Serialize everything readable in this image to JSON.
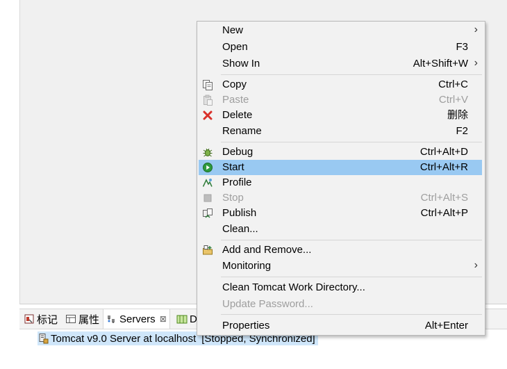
{
  "views": {
    "tabs": [
      {
        "label": "标记",
        "icon": "markers-icon"
      },
      {
        "label": "属性",
        "icon": "properties-icon"
      },
      {
        "label": "Servers",
        "icon": "servers-icon",
        "close": "⊠"
      },
      {
        "label": "D",
        "icon": "data-source-explorer-icon"
      }
    ]
  },
  "server": {
    "name": "Tomcat v9.0 Server at localhost",
    "status": "[Stopped, Synchronized]"
  },
  "context_menu": {
    "items": [
      {
        "label": "New",
        "shortcut": "",
        "submenu": true
      },
      {
        "label": "Open",
        "shortcut": "F3"
      },
      {
        "label": "Show In",
        "shortcut": "Alt+Shift+W",
        "submenu": true
      },
      {
        "label": "Copy",
        "shortcut": "Ctrl+C",
        "icon": "copy-icon"
      },
      {
        "label": "Paste",
        "shortcut": "Ctrl+V",
        "icon": "paste-icon",
        "disabled": true
      },
      {
        "label": "Delete",
        "shortcut": "删除",
        "icon": "delete-icon"
      },
      {
        "label": "Rename",
        "shortcut": "F2"
      },
      {
        "label": "Debug",
        "shortcut": "Ctrl+Alt+D",
        "icon": "debug-icon"
      },
      {
        "label": "Start",
        "shortcut": "Ctrl+Alt+R",
        "icon": "start-icon",
        "highlighted": true
      },
      {
        "label": "Profile",
        "shortcut": "",
        "icon": "profile-icon"
      },
      {
        "label": "Stop",
        "shortcut": "Ctrl+Alt+S",
        "icon": "stop-icon",
        "disabled": true
      },
      {
        "label": "Publish",
        "shortcut": "Ctrl+Alt+P",
        "icon": "publish-icon"
      },
      {
        "label": "Clean...",
        "shortcut": ""
      },
      {
        "label": "Add and Remove...",
        "shortcut": "",
        "icon": "add-remove-icon"
      },
      {
        "label": "Monitoring",
        "shortcut": "",
        "submenu": true
      },
      {
        "label": "Clean Tomcat Work Directory...",
        "shortcut": ""
      },
      {
        "label": "Update Password...",
        "shortcut": "",
        "disabled": true
      },
      {
        "label": "Properties",
        "shortcut": "Alt+Enter"
      }
    ],
    "submenu_arrow": "›"
  }
}
